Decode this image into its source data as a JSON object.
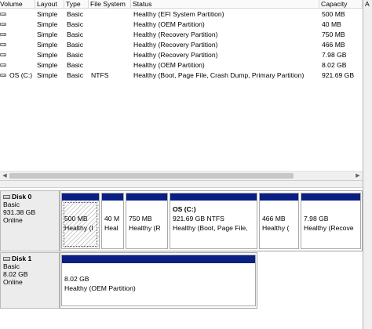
{
  "columns": [
    {
      "label": "Volume"
    },
    {
      "label": "Layout"
    },
    {
      "label": "Type"
    },
    {
      "label": "File System"
    },
    {
      "label": "Status"
    },
    {
      "label": "Capacity"
    }
  ],
  "right_header_label": "A",
  "volumes": [
    {
      "volume": "",
      "layout": "Simple",
      "type": "Basic",
      "fs": "",
      "status": "Healthy (EFI System Partition)",
      "capacity": "500 MB"
    },
    {
      "volume": "",
      "layout": "Simple",
      "type": "Basic",
      "fs": "",
      "status": "Healthy (OEM Partition)",
      "capacity": "40 MB"
    },
    {
      "volume": "",
      "layout": "Simple",
      "type": "Basic",
      "fs": "",
      "status": "Healthy (Recovery Partition)",
      "capacity": "750 MB"
    },
    {
      "volume": "",
      "layout": "Simple",
      "type": "Basic",
      "fs": "",
      "status": "Healthy (Recovery Partition)",
      "capacity": "466 MB"
    },
    {
      "volume": "",
      "layout": "Simple",
      "type": "Basic",
      "fs": "",
      "status": "Healthy (Recovery Partition)",
      "capacity": "7.98 GB"
    },
    {
      "volume": "",
      "layout": "Simple",
      "type": "Basic",
      "fs": "",
      "status": "Healthy (OEM Partition)",
      "capacity": "8.02 GB"
    },
    {
      "volume": "OS (C:)",
      "layout": "Simple",
      "type": "Basic",
      "fs": "NTFS",
      "status": "Healthy (Boot, Page File, Crash Dump, Primary Partition)",
      "capacity": "921.69 GB"
    }
  ],
  "disks": [
    {
      "title": "Disk 0",
      "type": "Basic",
      "size": "931.38 GB",
      "state": "Online",
      "partitions": [
        {
          "name": "",
          "size": "500 MB",
          "status": "Healthy (I"
        },
        {
          "name": "",
          "size": "40 M",
          "status": "Heal"
        },
        {
          "name": "",
          "size": "750 MB",
          "status": "Healthy (R"
        },
        {
          "name": "OS  (C:)",
          "size": "921.69 GB NTFS",
          "status": "Healthy (Boot, Page File,"
        },
        {
          "name": "",
          "size": "466 MB",
          "status": "Healthy ("
        },
        {
          "name": "",
          "size": "7.98 GB",
          "status": "Healthy (Recove"
        }
      ]
    },
    {
      "title": "Disk 1",
      "type": "Basic",
      "size": "8.02 GB",
      "state": "Online",
      "partitions": [
        {
          "name": "",
          "size": "8.02 GB",
          "status": "Healthy (OEM Partition)"
        }
      ]
    }
  ],
  "colors": {
    "partition_bar": "#0a1f82",
    "label_bg": "#ececec"
  }
}
